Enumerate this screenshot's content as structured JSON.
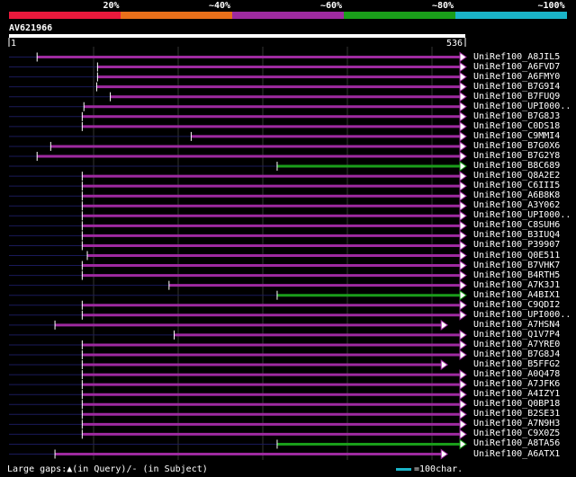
{
  "color_scale": {
    "labels": [
      "20%",
      "~40%",
      "~60%",
      "~80%",
      "~100%"
    ],
    "colors": [
      "#e8193c",
      "#e8701a",
      "#9e2aa0",
      "#1a9e1a",
      "#1ab4c8"
    ]
  },
  "query": {
    "id": "AV621966",
    "start": "1",
    "end": "536",
    "length": 536
  },
  "hits": [
    {
      "name": "UniRef100_A8JIL5",
      "qs": 33,
      "qe": 536,
      "color": "purple"
    },
    {
      "name": "UniRef100_A6FVD7",
      "qs": 104,
      "qe": 536,
      "color": "purple"
    },
    {
      "name": "UniRef100_A6FMY0",
      "qs": 104,
      "qe": 536,
      "color": "purple"
    },
    {
      "name": "UniRef100_B7G9I4",
      "qs": 103,
      "qe": 536,
      "color": "purple"
    },
    {
      "name": "UniRef100_B7FUQ9",
      "qs": 119,
      "qe": 536,
      "color": "purple"
    },
    {
      "name": "UniRef100_UPI000..",
      "qs": 88,
      "qe": 536,
      "color": "purple"
    },
    {
      "name": "UniRef100_B7G8J3",
      "qs": 86,
      "qe": 536,
      "color": "purple"
    },
    {
      "name": "UniRef100_C0DS18",
      "qs": 86,
      "qe": 536,
      "color": "purple"
    },
    {
      "name": "UniRef100_C9MMI4",
      "qs": 214,
      "qe": 536,
      "color": "purple"
    },
    {
      "name": "UniRef100_B7G0X6",
      "qs": 49,
      "qe": 536,
      "color": "purple"
    },
    {
      "name": "UniRef100_B7G2Y8",
      "qs": 33,
      "qe": 536,
      "color": "purple"
    },
    {
      "name": "UniRef100_B8C689",
      "qs": 315,
      "qe": 536,
      "color": "green"
    },
    {
      "name": "UniRef100_Q8A2E2",
      "qs": 86,
      "qe": 536,
      "color": "purple"
    },
    {
      "name": "UniRef100_C6III5",
      "qs": 86,
      "qe": 536,
      "color": "purple"
    },
    {
      "name": "UniRef100_A6B8K8",
      "qs": 86,
      "qe": 536,
      "color": "purple"
    },
    {
      "name": "UniRef100_A3Y062",
      "qs": 86,
      "qe": 536,
      "color": "purple"
    },
    {
      "name": "UniRef100_UPI000..",
      "qs": 86,
      "qe": 536,
      "color": "purple"
    },
    {
      "name": "UniRef100_C8SUH6",
      "qs": 86,
      "qe": 536,
      "color": "purple"
    },
    {
      "name": "UniRef100_B3IUQ4",
      "qs": 86,
      "qe": 536,
      "color": "purple"
    },
    {
      "name": "UniRef100_P39907",
      "qs": 86,
      "qe": 536,
      "color": "purple"
    },
    {
      "name": "UniRef100_Q0E511",
      "qs": 92,
      "qe": 536,
      "color": "purple"
    },
    {
      "name": "UniRef100_B7VHK7",
      "qs": 86,
      "qe": 536,
      "color": "purple"
    },
    {
      "name": "UniRef100_B4RTH5",
      "qs": 86,
      "qe": 536,
      "color": "purple"
    },
    {
      "name": "UniRef100_A7K3J1",
      "qs": 188,
      "qe": 536,
      "color": "purple"
    },
    {
      "name": "UniRef100_A4BIX1",
      "qs": 315,
      "qe": 536,
      "color": "green"
    },
    {
      "name": "UniRef100_C9QDI2",
      "qs": 86,
      "qe": 536,
      "color": "purple"
    },
    {
      "name": "UniRef100_UPI000..",
      "qs": 86,
      "qe": 536,
      "color": "purple"
    },
    {
      "name": "UniRef100_A7HSN4",
      "qs": 54,
      "qe": 514,
      "color": "purple"
    },
    {
      "name": "UniRef100_Q1V7P4",
      "qs": 194,
      "qe": 536,
      "color": "purple"
    },
    {
      "name": "UniRef100_A7YRE0",
      "qs": 86,
      "qe": 536,
      "color": "purple"
    },
    {
      "name": "UniRef100_B7G8J4",
      "qs": 86,
      "qe": 536,
      "color": "purple"
    },
    {
      "name": "UniRef100_B5FFG2",
      "qs": 86,
      "qe": 514,
      "color": "purple"
    },
    {
      "name": "UniRef100_A0Q478",
      "qs": 86,
      "qe": 536,
      "color": "purple"
    },
    {
      "name": "UniRef100_A7JFK6",
      "qs": 86,
      "qe": 536,
      "color": "purple"
    },
    {
      "name": "UniRef100_A4IZY1",
      "qs": 86,
      "qe": 536,
      "color": "purple"
    },
    {
      "name": "UniRef100_Q0BP18",
      "qs": 86,
      "qe": 536,
      "color": "purple"
    },
    {
      "name": "UniRef100_B2SE31",
      "qs": 86,
      "qe": 536,
      "color": "purple"
    },
    {
      "name": "UniRef100_A7N9H3",
      "qs": 86,
      "qe": 536,
      "color": "purple"
    },
    {
      "name": "UniRef100_C9X0Z5",
      "qs": 86,
      "qe": 536,
      "color": "purple"
    },
    {
      "name": "UniRef100_A8TA56",
      "qs": 315,
      "qe": 536,
      "color": "green"
    },
    {
      "name": "UniRef100_A6ATX1",
      "qs": 54,
      "qe": 514,
      "color": "purple"
    }
  ],
  "footer": {
    "gaps_text": "Large gaps:▲(in Query)/- (in Subject)",
    "scale_text": "=100char."
  }
}
